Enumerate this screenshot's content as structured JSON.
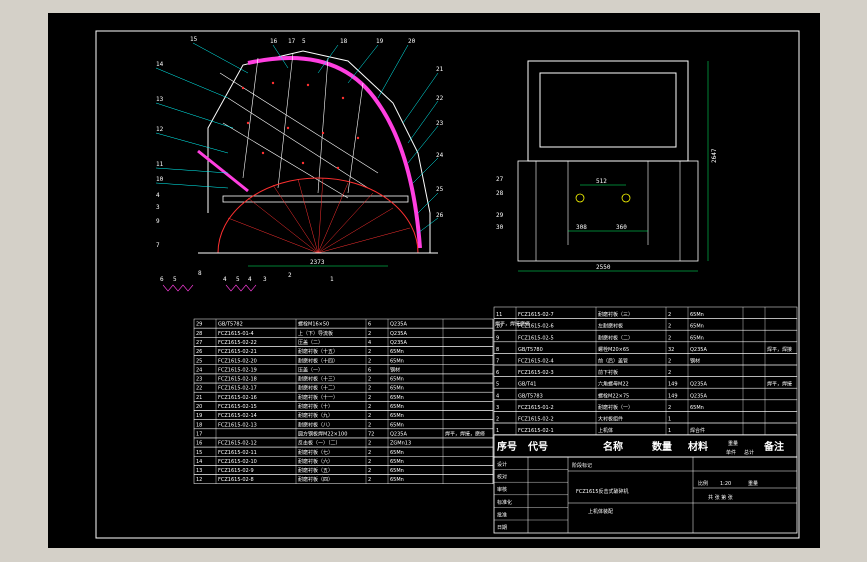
{
  "drawing": {
    "front_view_labels": [
      "15",
      "16",
      "17",
      "5",
      "18",
      "19",
      "20",
      "21",
      "22",
      "23",
      "24",
      "25",
      "26",
      "14",
      "13",
      "12",
      "11",
      "10",
      "4",
      "3",
      "9",
      "7",
      "8",
      "6",
      "5",
      "4",
      "5",
      "4",
      "3",
      "2",
      "1"
    ],
    "dim_front": "2373",
    "dim_side_width": "2550",
    "dim_side_height": "2647",
    "dim_hole_spacing": "512",
    "dim_inner_a": "308",
    "dim_inner_b": "360",
    "side_view_labels": [
      "27",
      "28",
      "29",
      "30"
    ]
  },
  "bom_left": [
    [
      "29",
      "GB/T5782",
      "螺栓M16×50",
      "6",
      "Q235A",
      "",
      "焊平，焊接磨修"
    ],
    [
      "28",
      "FCZ1615-01-4",
      "上（下）导流板",
      "2",
      "Q235A",
      "",
      ""
    ],
    [
      "27",
      "FCZ1615-02-22",
      "压盖（二）",
      "4",
      "Q235A",
      "",
      ""
    ],
    [
      "26",
      "FCZ1615-02-21",
      "耐磨衬板（十五）",
      "2",
      "65Mn",
      "",
      ""
    ],
    [
      "25",
      "FCZ1615-02-20",
      "耐磨衬板（十四）",
      "2",
      "65Mn",
      "",
      ""
    ],
    [
      "24",
      "FCZ1615-02-19",
      "压盖（一）",
      "6",
      "钢材",
      "",
      ""
    ],
    [
      "23",
      "FCZ1615-02-18",
      "耐磨衬板（十三）",
      "2",
      "65Mn",
      "",
      ""
    ],
    [
      "22",
      "FCZ1615-02-17",
      "耐磨衬板（十二）",
      "2",
      "65Mn",
      "",
      ""
    ],
    [
      "21",
      "FCZ1615-02-16",
      "耐磨衬板（十一）",
      "2",
      "65Mn",
      "",
      ""
    ],
    [
      "20",
      "FCZ1615-02-15",
      "耐磨衬板（十）",
      "2",
      "65Mn",
      "",
      ""
    ],
    [
      "19",
      "FCZ1615-02-14",
      "耐磨衬板（九）",
      "2",
      "65Mn",
      "",
      ""
    ],
    [
      "18",
      "FCZ1615-02-13",
      "耐磨衬板（八）",
      "2",
      "65Mn",
      "",
      ""
    ],
    [
      "17",
      "",
      "圆方钢板焊M22×100",
      "72",
      "Q235A",
      "焊平，焊接，磨修",
      ""
    ],
    [
      "16",
      "FCZ1615-02-12",
      "反击板（一）（二）",
      "2",
      "ZGMn13",
      "",
      ""
    ],
    [
      "15",
      "FCZ1615-02-11",
      "耐磨衬板（七）",
      "2",
      "65Mn",
      "",
      ""
    ],
    [
      "14",
      "FCZ1615-02-10",
      "耐磨衬板（六）",
      "2",
      "65Mn",
      "",
      ""
    ],
    [
      "13",
      "FCZ1615-02-9",
      "耐磨衬板（五）",
      "2",
      "65Mn",
      "",
      ""
    ],
    [
      "12",
      "FCZ1615-02-8",
      "耐磨衬板（四）",
      "2",
      "65Mn",
      "",
      ""
    ]
  ],
  "bom_right": [
    [
      "11",
      "FCZ1615-02-7",
      "耐磨衬板（三）",
      "2",
      "65Mn",
      "",
      ""
    ],
    [
      "10",
      "FCZ1615-02-6",
      "左耐磨衬板",
      "2",
      "65Mn",
      "",
      ""
    ],
    [
      "9",
      "FCZ1615-02-5",
      "耐磨衬板（二）",
      "2",
      "65Mn",
      "",
      ""
    ],
    [
      "8",
      "GB/T5780",
      "螺栓M20×65",
      "32",
      "Q235A",
      "",
      "焊平，焊接"
    ],
    [
      "7",
      "FCZ1615-02-4",
      "前（后）盖管",
      "2",
      "钢材",
      "",
      ""
    ],
    [
      "6",
      "FCZ1615-02-3",
      "前下衬板",
      "2",
      "",
      "",
      ""
    ],
    [
      "5",
      "GB/T41",
      "六角螺母M22",
      "149",
      "Q235A",
      "",
      "焊平，焊接"
    ],
    [
      "4",
      "GB/T5783",
      "螺栓M22×75",
      "149",
      "Q235A",
      "",
      ""
    ],
    [
      "3",
      "FCZ1615-01-2",
      "耐磨衬板（一）",
      "2",
      "65Mn",
      "",
      ""
    ],
    [
      "2",
      "FCZ1615-02-2",
      "大衬板组件",
      "1",
      "",
      "",
      ""
    ],
    [
      "1",
      "FCZ1615-02-1",
      "上机体",
      "1",
      "焊合件",
      "",
      ""
    ]
  ],
  "bom_header": [
    "序号",
    "代号",
    "名称",
    "数量",
    "材料",
    "单件",
    "总计",
    "备注"
  ],
  "bom_header_weight": [
    "重量"
  ],
  "title_block": {
    "rows_left": [
      "设计",
      "校对",
      "审核",
      "标准化",
      "批准",
      "日期"
    ],
    "project": "FCZ1615反击式破碎机",
    "part": "上机体装配",
    "stage": "阶段标记",
    "scale_label": "比例",
    "scale": "1:20",
    "weight_label": "重量",
    "sheet": "共  张  第  张"
  },
  "colors": {
    "background": "#000000",
    "line": "#ffffff",
    "wear_plate": "#ff3fe0",
    "hatch": "#ff3030",
    "leader": "#00ffff",
    "dimension": "#00ff66",
    "border": "#d4d0c8"
  }
}
